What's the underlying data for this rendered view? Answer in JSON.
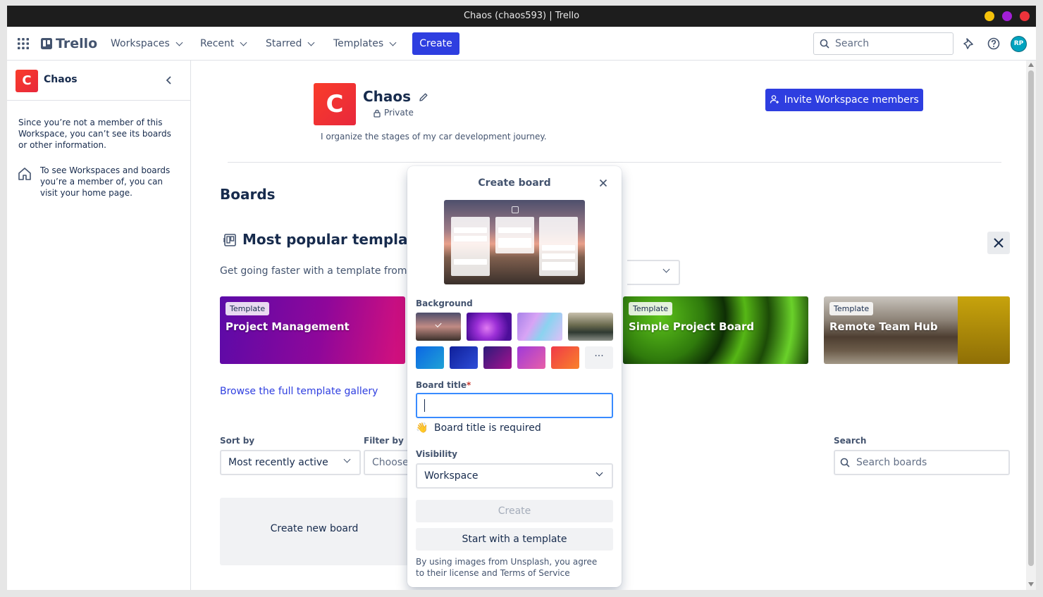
{
  "window": {
    "title": "Chaos (chaos593) | Trello",
    "controls": [
      "minimize",
      "maximize",
      "close"
    ]
  },
  "nav": {
    "brand": "Trello",
    "items": [
      "Workspaces",
      "Recent",
      "Starred",
      "Templates"
    ],
    "create_label": "Create",
    "search_placeholder": "Search",
    "avatar_initials": "RP"
  },
  "sidebar": {
    "workspace_initial": "C",
    "workspace_name": "Chaos",
    "notice": "Since you’re not a member of this Workspace, you can’t see its boards or other information.",
    "home_notice": "To see Workspaces and boards you’re a member of, you can visit your home page."
  },
  "workspace": {
    "initial": "C",
    "name": "Chaos",
    "privacy": "Private",
    "description": "I organize the stages of my car development journey.",
    "invite_label": "Invite Workspace members"
  },
  "boards": {
    "heading": "Boards",
    "templates_heading": "Most popular templates",
    "templates_subtext": "Get going faster with a template from the",
    "template_badge": "Template",
    "templates": [
      "Project Management",
      "Simple Project Board",
      "Remote Team Hub"
    ],
    "gallery_link": "Browse the full template gallery",
    "sort_label": "Sort by",
    "sort_value": "Most recently active",
    "filter_label": "Filter by",
    "filter_value": "Choose a",
    "search_label": "Search",
    "search_placeholder": "Search boards",
    "create_new": "Create new board"
  },
  "create_board": {
    "title": "Create board",
    "background_label": "Background",
    "more_label": "···",
    "board_title_label": "Board title",
    "required_mark": "*",
    "error_emoji": "👋",
    "error_text": "Board title is required",
    "board_title_value": "",
    "visibility_label": "Visibility",
    "visibility_value": "Workspace",
    "create_label": "Create",
    "template_label": "Start with a template",
    "footer": "By using images from Unsplash, you agree to their license and Terms of Service"
  },
  "colors": {
    "primary": "#2e3ee0",
    "text": "#172b4d",
    "subtle_text": "#44546f",
    "focus": "#388bff"
  }
}
